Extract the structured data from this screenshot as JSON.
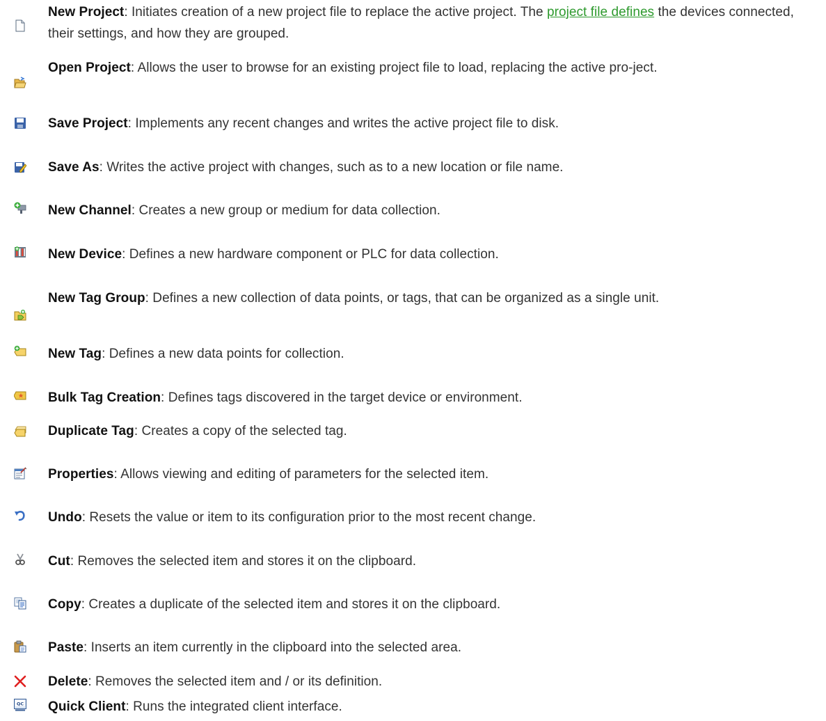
{
  "items": [
    {
      "icon": "new-project-icon",
      "title": "New Project",
      "desc_before": ": Initiates creation of a new project file to replace the active project. The ",
      "link": "project file defines",
      "desc_after": " the devices connected, their settings, and how they are grouped."
    },
    {
      "icon": "open-project-icon",
      "title": "Open Project",
      "desc": ": Allows the user to browse for an existing project file to load, replacing the active pro-ject."
    },
    {
      "icon": "save-project-icon",
      "title": "Save Project",
      "desc": ": Implements any recent changes and writes the active project file to disk."
    },
    {
      "icon": "save-as-icon",
      "title": "Save As",
      "desc": ": Writes the active project with changes, such as to a new location or file name."
    },
    {
      "icon": "new-channel-icon",
      "title": "New Channel",
      "desc": ": Creates a new group or medium for data collection."
    },
    {
      "icon": "new-device-icon",
      "title": "New Device",
      "desc": ": Defines a new hardware component or PLC for data collection."
    },
    {
      "icon": "new-tag-group-icon",
      "title": "New Tag Group",
      "desc": ": Defines a new collection of data points, or tags, that can be organized as a single unit."
    },
    {
      "icon": "new-tag-icon",
      "title": "New Tag",
      "desc": ": Defines a new data points for collection."
    },
    {
      "icon": "bulk-tag-creation-icon",
      "title": "Bulk Tag Creation",
      "desc": ": Defines tags discovered in the target device or environment."
    },
    {
      "icon": "duplicate-tag-icon",
      "title": "Duplicate Tag",
      "desc": ": Creates a copy of the selected tag."
    },
    {
      "icon": "properties-icon",
      "title": "Properties",
      "desc": ": Allows viewing and editing of parameters for the selected item."
    },
    {
      "icon": "undo-icon",
      "title": "Undo",
      "desc": ": Resets the value or item to its configuration prior to the most recent change."
    },
    {
      "icon": "cut-icon",
      "title": "Cut",
      "desc": ": Removes the selected item and stores it on the clipboard."
    },
    {
      "icon": "copy-icon",
      "title": "Copy",
      "desc": ": Creates a duplicate of the selected item and stores it on the clipboard."
    },
    {
      "icon": "paste-icon",
      "title": "Paste",
      "desc": ": Inserts an item currently in the clipboard into the selected area."
    },
    {
      "icon": "delete-icon",
      "title": "Delete",
      "desc": ": Removes the selected item and / or its definition."
    },
    {
      "icon": "quick-client-icon",
      "title": "Quick Client",
      "desc": ": Runs the integrated client interface."
    }
  ]
}
